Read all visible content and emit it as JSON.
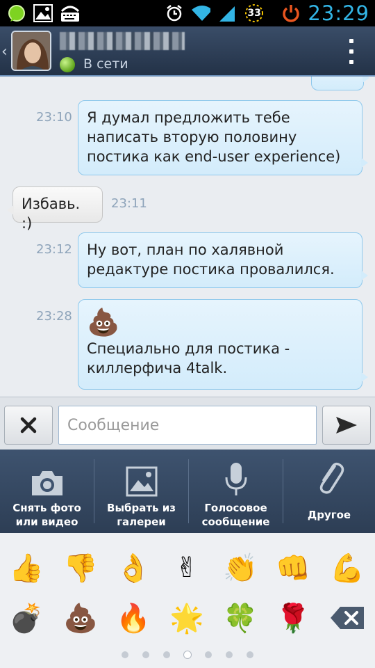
{
  "status_bar": {
    "time": "23:29",
    "badge_number": "33",
    "icons": [
      "chat-status-icon",
      "gallery-icon",
      "keyboard-icon",
      "alarm-icon",
      "wifi-icon",
      "signal-icon",
      "power-icon"
    ]
  },
  "header": {
    "contact_status": "В сети",
    "accent_color": "#33b5e5"
  },
  "messages": [
    {
      "dir": "out",
      "time": "23:10",
      "text": "Я думал предложить тебе написать вторую половину постика как end-user experience)"
    },
    {
      "dir": "in",
      "time": "23:11",
      "text": "Избавь. :)"
    },
    {
      "dir": "out",
      "time": "23:12",
      "text": "Ну вот, план по халявной редактуре постика провалился."
    },
    {
      "dir": "out",
      "time": "23:28",
      "emoji": "💩",
      "text": "Специально для постика - киллерфича 4talk."
    }
  ],
  "composer": {
    "placeholder": "Сообщение"
  },
  "attach_bar": {
    "items": [
      {
        "label": "Снять фото или видео",
        "icon": "camera-icon"
      },
      {
        "label": "Выбрать из галереи",
        "icon": "gallery-icon"
      },
      {
        "label": "Голосовое сообщение",
        "icon": "microphone-icon"
      },
      {
        "label": "Другое",
        "icon": "paperclip-icon"
      }
    ]
  },
  "emoji_panel": {
    "row1": [
      "👍",
      "👎",
      "👌",
      "✌",
      "👏",
      "👊",
      "💪"
    ],
    "row2": [
      "💣",
      "💩",
      "🔥",
      "🌟",
      "🍀",
      "🌹"
    ],
    "pages_count": 7,
    "active_page": 4
  }
}
